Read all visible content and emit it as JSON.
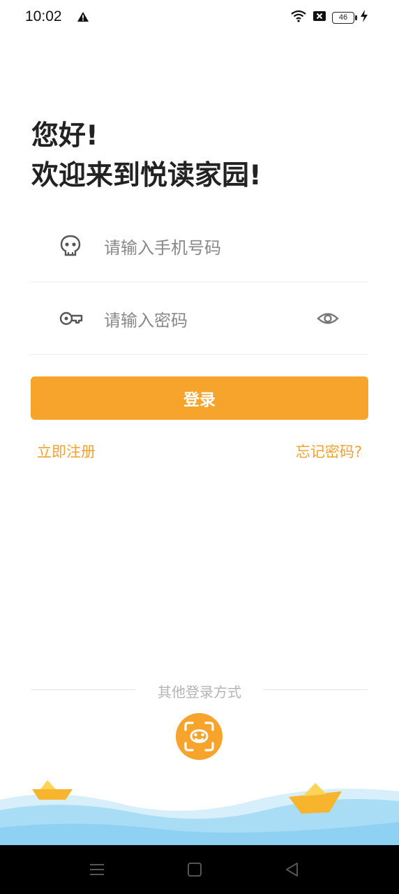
{
  "status_bar": {
    "time": "10:02",
    "battery": "46",
    "icons": [
      "warning-icon",
      "wifi-icon",
      "sim-off-icon",
      "battery-icon",
      "charging-icon"
    ]
  },
  "greeting": {
    "line1": "您好!",
    "line2": "欢迎来到悦读家园!"
  },
  "form": {
    "phone_placeholder": "请输入手机号码",
    "password_placeholder": "请输入密码",
    "login_label": "登录"
  },
  "links": {
    "register": "立即注册",
    "forgot": "忘记密码?"
  },
  "other_login": {
    "label": "其他登录方式"
  },
  "colors": {
    "accent": "#f7a42d",
    "link": "#f0a232",
    "wave": "#a9dcf5"
  }
}
